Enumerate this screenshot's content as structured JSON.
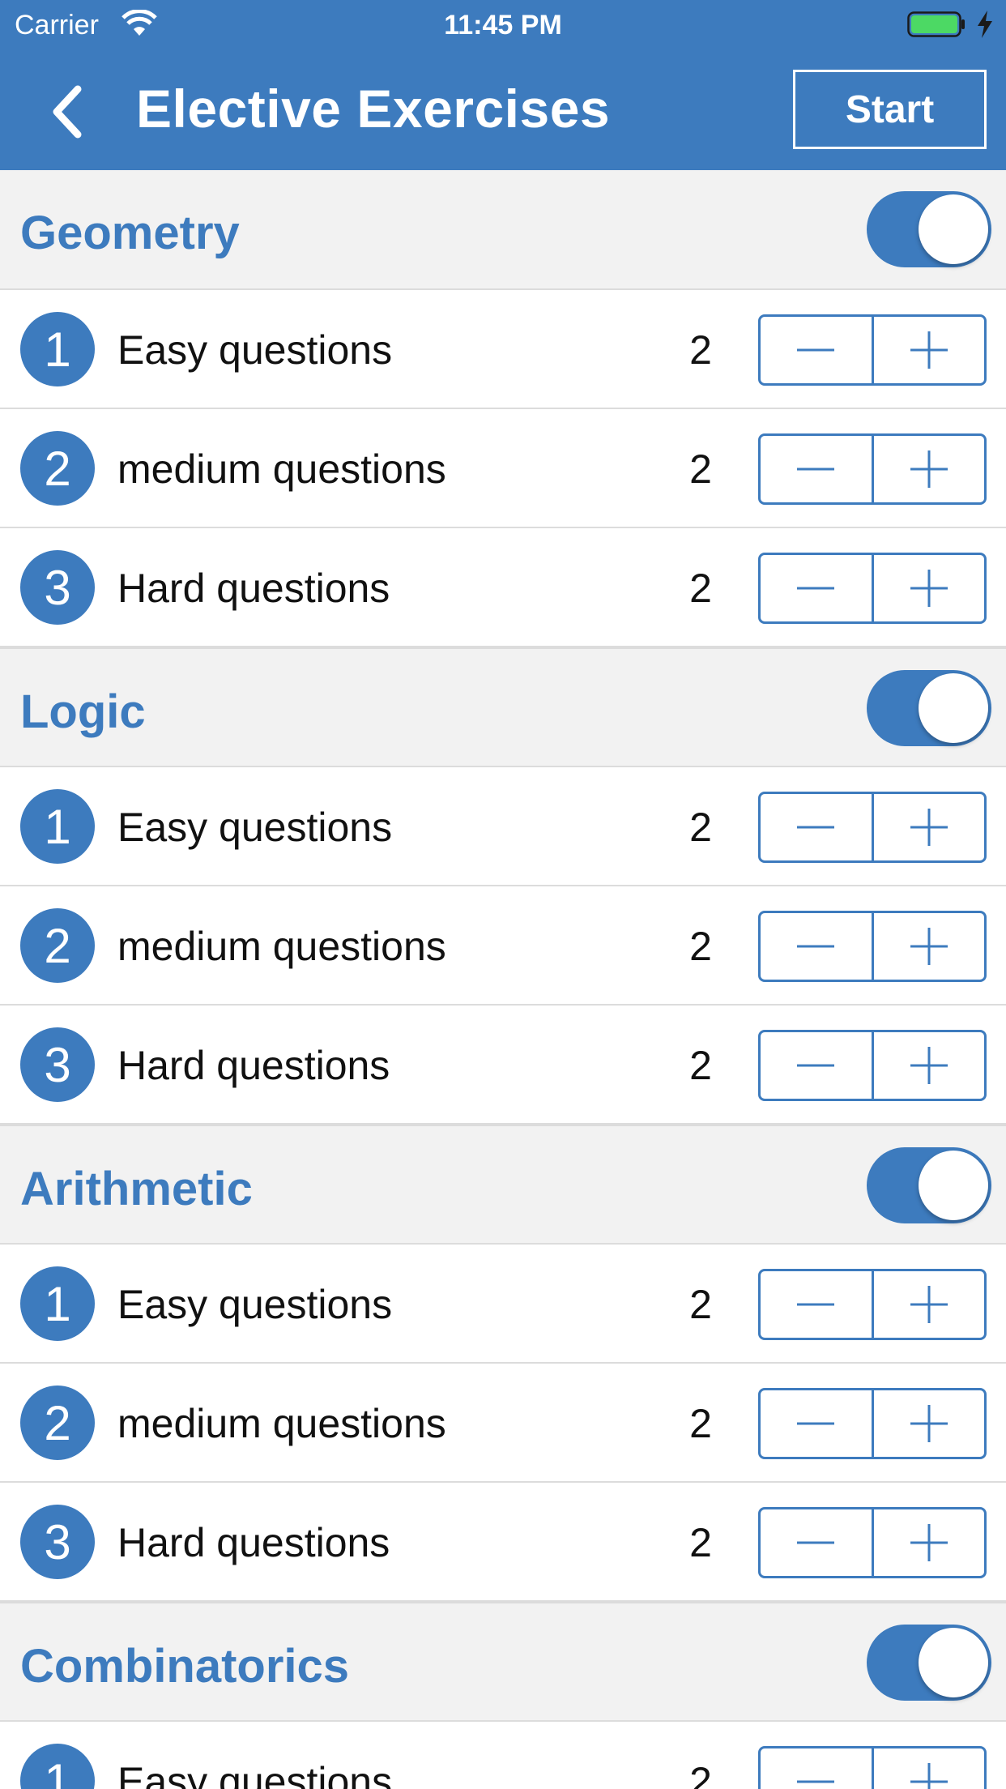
{
  "status_bar": {
    "carrier": "Carrier",
    "time": "11:45 PM"
  },
  "nav": {
    "title": "Elective Exercises",
    "start_label": "Start"
  },
  "colors": {
    "accent": "#3d7bbe",
    "battery_fill": "#4cd964",
    "section_bg": "#f2f2f2"
  },
  "sections": [
    {
      "name": "Geometry",
      "enabled": true,
      "rows": [
        {
          "number": "1",
          "label": "Easy questions",
          "count": "2"
        },
        {
          "number": "2",
          "label": "medium questions",
          "count": "2"
        },
        {
          "number": "3",
          "label": "Hard questions",
          "count": "2"
        }
      ]
    },
    {
      "name": "Logic",
      "enabled": true,
      "rows": [
        {
          "number": "1",
          "label": "Easy questions",
          "count": "2"
        },
        {
          "number": "2",
          "label": "medium questions",
          "count": "2"
        },
        {
          "number": "3",
          "label": "Hard questions",
          "count": "2"
        }
      ]
    },
    {
      "name": "Arithmetic",
      "enabled": true,
      "rows": [
        {
          "number": "1",
          "label": "Easy questions",
          "count": "2"
        },
        {
          "number": "2",
          "label": "medium questions",
          "count": "2"
        },
        {
          "number": "3",
          "label": "Hard questions",
          "count": "2"
        }
      ]
    },
    {
      "name": "Combinatorics",
      "enabled": true,
      "rows": [
        {
          "number": "1",
          "label": "Easy questions",
          "count": "2"
        }
      ]
    }
  ]
}
